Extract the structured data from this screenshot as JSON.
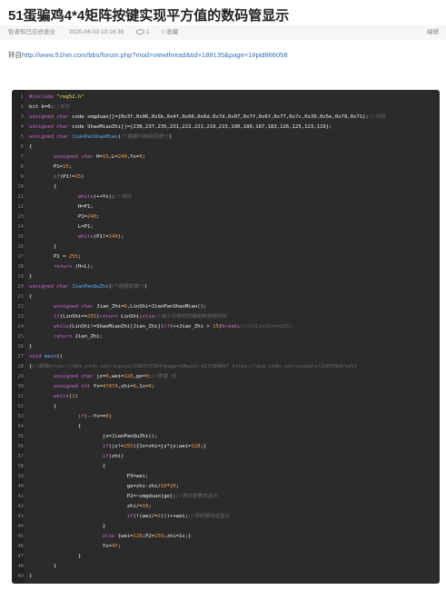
{
  "article": {
    "title": "51蛋骗鸡4*4矩阵按键实现平方值的数码管显示",
    "author": "智者知已应修善业",
    "date": "2020-06-03 10:16:35",
    "views": "1",
    "favorite_label": "收藏",
    "edit_label": "编辑",
    "repost_prefix": "转自",
    "repost_url": "http://www.51hei.com/bbs/forum.php?mod=viewthread&tid=189135&page=1#pid866058"
  },
  "code": {
    "colors": {
      "keyword": "#d267d2",
      "string": "#e7e24a",
      "number": "#ff9a3c",
      "comment": "#6c6c6c",
      "function": "#5db3ff",
      "text": "#f0f0f0"
    },
    "lines": [
      [
        [
          "kw",
          "#include "
        ],
        [
          "str",
          "\"reg52.h\""
        ]
      ],
      [
        [
          "tx",
          "bit k=0;"
        ],
        [
          "cm",
          "//标志"
        ]
      ],
      [
        [
          "kw",
          "unsigned char "
        ],
        [
          "tx",
          "code smgduan[]={0x3f,0x06,0x5b,0x4f,0x66,0x6d,0x7d,0x07,0x7f,0x6f,0x77,0x7c,0x39,0x5e,0x79,0x71};"
        ],
        [
          "cm",
          "//共阴"
        ]
      ],
      [
        [
          "kw",
          "unsigned char "
        ],
        [
          "tx",
          "code ShaoMiaoZhi[]={238,237,235,231,222,221,219,215,190,189,187,183,126,125,123,119};"
        ]
      ],
      [
        [
          "kw",
          "unsigned char "
        ],
        [
          "fn",
          "JianPanShaoMiao"
        ],
        [
          "tx",
          "("
        ],
        [
          "cm",
          "/*键盘扫描返回值*/"
        ],
        [
          "tx",
          ")"
        ]
      ],
      [
        [
          "tx",
          "{"
        ]
      ],
      [
        [
          "tx",
          "        "
        ],
        [
          "kw",
          "unsigned char "
        ],
        [
          "tx",
          "H="
        ],
        [
          "num",
          "15"
        ],
        [
          "tx",
          ",L="
        ],
        [
          "num",
          "240"
        ],
        [
          "tx",
          ",Ys="
        ],
        [
          "num",
          "0"
        ],
        [
          "tx",
          ";"
        ]
      ],
      [
        [
          "tx",
          "        P1="
        ],
        [
          "num",
          "15"
        ],
        [
          "tx",
          ";"
        ]
      ],
      [
        [
          "tx",
          "        "
        ],
        [
          "kw",
          "if"
        ],
        [
          "tx",
          "(P1!="
        ],
        [
          "num",
          "15"
        ],
        [
          "tx",
          ")"
        ]
      ],
      [
        [
          "tx",
          "        {"
        ]
      ],
      [
        [
          "tx",
          "                "
        ],
        [
          "kw",
          "while"
        ],
        [
          "tx",
          "(++Ys);"
        ],
        [
          "cm",
          "//消抖"
        ]
      ],
      [
        [
          "tx",
          "                H=P1;"
        ]
      ],
      [
        [
          "tx",
          "                P1="
        ],
        [
          "num",
          "240"
        ],
        [
          "tx",
          ";"
        ]
      ],
      [
        [
          "tx",
          "                L=P1;"
        ]
      ],
      [
        [
          "tx",
          "                "
        ],
        [
          "kw",
          "while"
        ],
        [
          "tx",
          "(P1!="
        ],
        [
          "num",
          "240"
        ],
        [
          "tx",
          ");"
        ]
      ],
      [
        [
          "tx",
          "        }"
        ]
      ],
      [
        [
          "tx",
          "        P1 = "
        ],
        [
          "num",
          "255"
        ],
        [
          "tx",
          ";"
        ]
      ],
      [
        [
          "tx",
          "        "
        ],
        [
          "kw",
          "return "
        ],
        [
          "tx",
          "(H+L);"
        ]
      ],
      [
        [
          "tx",
          "}"
        ]
      ],
      [
        [
          "kw",
          "unsigned char "
        ],
        [
          "fn",
          "JianPanQuZhi"
        ],
        [
          "tx",
          "("
        ],
        [
          "cm",
          "/*按键取值*/"
        ],
        [
          "tx",
          ")"
        ]
      ],
      [
        [
          "tx",
          "{"
        ]
      ],
      [
        [
          "tx",
          "        "
        ],
        [
          "kw",
          "unsigned char "
        ],
        [
          "tx",
          "Jian_Zhi="
        ],
        [
          "num",
          "0"
        ],
        [
          "tx",
          ",LinShi=JianPanShaoMiao();"
        ]
      ],
      [
        [
          "tx",
          "        "
        ],
        [
          "kw",
          "if"
        ],
        [
          "tx",
          "(LinShi=="
        ],
        [
          "num",
          "255"
        ],
        [
          "tx",
          ")"
        ],
        [
          "kw",
          "return "
        ],
        [
          "tx",
          "LinShi;"
        ],
        [
          "kw",
          "else"
        ],
        [
          "cm",
          "//减小无按时扫描函数调用时间"
        ]
      ],
      [
        [
          "tx",
          "        "
        ],
        [
          "kw",
          "while"
        ],
        [
          "tx",
          "(LinShi!=ShaoMiaoZhi[Jian_Zhi])"
        ],
        [
          "kw",
          "if"
        ],
        [
          "tx",
          "(++Jian_Zhi > "
        ],
        [
          "num",
          "15"
        ],
        [
          "tx",
          ")"
        ],
        [
          "kw",
          "break"
        ],
        [
          "tx",
          ";"
        ],
        [
          "cm",
          "//if(LinShi==255)"
        ]
      ],
      [
        [
          "tx",
          "        "
        ],
        [
          "kw",
          "return "
        ],
        [
          "tx",
          "Jian_Zhi;"
        ]
      ],
      [
        [
          "tx",
          "}"
        ]
      ],
      [
        [
          "kw",
          "void "
        ],
        [
          "fn",
          "main"
        ],
        [
          "tx",
          "()"
        ]
      ],
      [
        [
          "tx",
          "{"
        ],
        [
          "cm",
          "//摘自https://bbs.csdn.net/topics/396377304?page=1#post-411560687 https://ask.csdn.net/answers/1282564/edit"
        ]
      ],
      [
        [
          "tx",
          "        "
        ],
        [
          "kw",
          "unsigned char "
        ],
        [
          "tx",
          "jz="
        ],
        [
          "num",
          "0"
        ],
        [
          "tx",
          ",wei="
        ],
        [
          "num",
          "128"
        ],
        [
          "tx",
          ",ge="
        ],
        [
          "num",
          "0"
        ],
        [
          "tx",
          ";"
        ],
        [
          "cm",
          "//数值 位"
        ]
      ],
      [
        [
          "tx",
          "        "
        ],
        [
          "kw",
          "unsigned int "
        ],
        [
          "tx",
          "Ys="
        ],
        [
          "num",
          "47474"
        ],
        [
          "tx",
          ",zhi="
        ],
        [
          "num",
          "0"
        ],
        [
          "tx",
          ",1s="
        ],
        [
          "num",
          "0"
        ],
        [
          "tx",
          ";"
        ]
      ],
      [
        [
          "tx",
          "        "
        ],
        [
          "kw",
          "while"
        ],
        [
          "tx",
          "("
        ],
        [
          "num",
          "1"
        ],
        [
          "tx",
          ")"
        ]
      ],
      [
        [
          "tx",
          "        {"
        ]
      ],
      [
        [
          "tx",
          "                "
        ],
        [
          "kw",
          "if"
        ],
        [
          "tx",
          "(--Ys=="
        ],
        [
          "num",
          "0"
        ],
        [
          "tx",
          ")"
        ]
      ],
      [
        [
          "tx",
          "                {"
        ]
      ],
      [
        [
          "tx",
          "                        jz=JianPanQuZhi();"
        ]
      ],
      [
        [
          "tx",
          "                        "
        ],
        [
          "kw",
          "if"
        ],
        [
          "tx",
          "(jz!="
        ],
        [
          "num",
          "255"
        ],
        [
          "tx",
          ")"
        ],
        [
          "tx",
          "{1s=zhi=jz*jz;wei="
        ],
        [
          "num",
          "128"
        ],
        [
          "tx",
          ";}"
        ]
      ],
      [
        [
          "tx",
          "                        "
        ],
        [
          "kw",
          "if"
        ],
        [
          "tx",
          "(zhi)"
        ]
      ],
      [
        [
          "tx",
          "                        {"
        ]
      ],
      [
        [
          "tx",
          "                                P3=wei;"
        ]
      ],
      [
        [
          "tx",
          "                                ge=zhi-zhi/"
        ],
        [
          "num",
          "10"
        ],
        [
          "tx",
          "*"
        ],
        [
          "num",
          "10"
        ],
        [
          "tx",
          ";"
        ]
      ],
      [
        [
          "tx",
          "                                P2=~smgduan[ge];"
        ],
        [
          "cm",
          "//数码管静态显示"
        ]
      ],
      [
        [
          "tx",
          "                                zhi/="
        ],
        [
          "num",
          "10"
        ],
        [
          "tx",
          ";"
        ]
      ],
      [
        [
          "tx",
          "                                "
        ],
        [
          "kw",
          "if"
        ],
        [
          "tx",
          "(!(wei/="
        ],
        [
          "num",
          "2"
        ],
        [
          "tx",
          ")))++wei;"
        ],
        [
          "cm",
          "//数码管动态显示"
        ]
      ],
      [
        [
          "tx",
          "                        }"
        ]
      ],
      [
        [
          "tx",
          "                        "
        ],
        [
          "kw",
          "else "
        ],
        [
          "tx",
          "{wei="
        ],
        [
          "num",
          "128"
        ],
        [
          "tx",
          ";P2="
        ],
        [
          "num",
          "255"
        ],
        [
          "tx",
          ";zhi=1s;}"
        ]
      ],
      [
        [
          "tx",
          "                        Ys="
        ],
        [
          "num",
          "47"
        ],
        [
          "tx",
          ";"
        ]
      ],
      [
        [
          "tx",
          "                }"
        ]
      ],
      [
        [
          "tx",
          "        }"
        ]
      ],
      [
        [
          "tx",
          "}"
        ]
      ]
    ]
  }
}
